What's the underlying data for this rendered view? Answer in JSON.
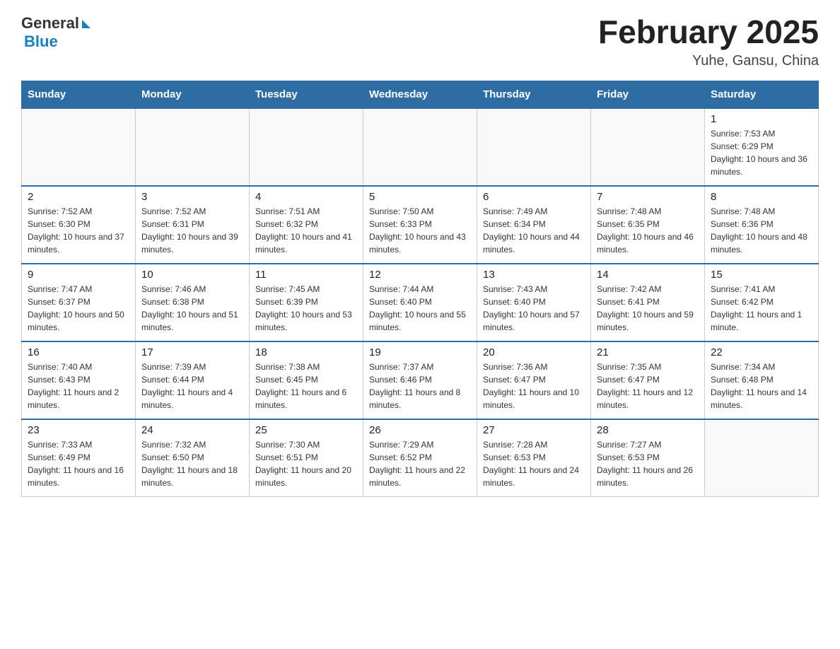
{
  "header": {
    "logo_general": "General",
    "logo_blue": "Blue",
    "month_title": "February 2025",
    "location": "Yuhe, Gansu, China"
  },
  "weekdays": [
    "Sunday",
    "Monday",
    "Tuesday",
    "Wednesday",
    "Thursday",
    "Friday",
    "Saturday"
  ],
  "weeks": [
    [
      {
        "day": "",
        "empty": true
      },
      {
        "day": "",
        "empty": true
      },
      {
        "day": "",
        "empty": true
      },
      {
        "day": "",
        "empty": true
      },
      {
        "day": "",
        "empty": true
      },
      {
        "day": "",
        "empty": true
      },
      {
        "day": "1",
        "sunrise": "7:53 AM",
        "sunset": "6:29 PM",
        "daylight": "10 hours and 36 minutes."
      }
    ],
    [
      {
        "day": "2",
        "sunrise": "7:52 AM",
        "sunset": "6:30 PM",
        "daylight": "10 hours and 37 minutes."
      },
      {
        "day": "3",
        "sunrise": "7:52 AM",
        "sunset": "6:31 PM",
        "daylight": "10 hours and 39 minutes."
      },
      {
        "day": "4",
        "sunrise": "7:51 AM",
        "sunset": "6:32 PM",
        "daylight": "10 hours and 41 minutes."
      },
      {
        "day": "5",
        "sunrise": "7:50 AM",
        "sunset": "6:33 PM",
        "daylight": "10 hours and 43 minutes."
      },
      {
        "day": "6",
        "sunrise": "7:49 AM",
        "sunset": "6:34 PM",
        "daylight": "10 hours and 44 minutes."
      },
      {
        "day": "7",
        "sunrise": "7:48 AM",
        "sunset": "6:35 PM",
        "daylight": "10 hours and 46 minutes."
      },
      {
        "day": "8",
        "sunrise": "7:48 AM",
        "sunset": "6:36 PM",
        "daylight": "10 hours and 48 minutes."
      }
    ],
    [
      {
        "day": "9",
        "sunrise": "7:47 AM",
        "sunset": "6:37 PM",
        "daylight": "10 hours and 50 minutes."
      },
      {
        "day": "10",
        "sunrise": "7:46 AM",
        "sunset": "6:38 PM",
        "daylight": "10 hours and 51 minutes."
      },
      {
        "day": "11",
        "sunrise": "7:45 AM",
        "sunset": "6:39 PM",
        "daylight": "10 hours and 53 minutes."
      },
      {
        "day": "12",
        "sunrise": "7:44 AM",
        "sunset": "6:40 PM",
        "daylight": "10 hours and 55 minutes."
      },
      {
        "day": "13",
        "sunrise": "7:43 AM",
        "sunset": "6:40 PM",
        "daylight": "10 hours and 57 minutes."
      },
      {
        "day": "14",
        "sunrise": "7:42 AM",
        "sunset": "6:41 PM",
        "daylight": "10 hours and 59 minutes."
      },
      {
        "day": "15",
        "sunrise": "7:41 AM",
        "sunset": "6:42 PM",
        "daylight": "11 hours and 1 minute."
      }
    ],
    [
      {
        "day": "16",
        "sunrise": "7:40 AM",
        "sunset": "6:43 PM",
        "daylight": "11 hours and 2 minutes."
      },
      {
        "day": "17",
        "sunrise": "7:39 AM",
        "sunset": "6:44 PM",
        "daylight": "11 hours and 4 minutes."
      },
      {
        "day": "18",
        "sunrise": "7:38 AM",
        "sunset": "6:45 PM",
        "daylight": "11 hours and 6 minutes."
      },
      {
        "day": "19",
        "sunrise": "7:37 AM",
        "sunset": "6:46 PM",
        "daylight": "11 hours and 8 minutes."
      },
      {
        "day": "20",
        "sunrise": "7:36 AM",
        "sunset": "6:47 PM",
        "daylight": "11 hours and 10 minutes."
      },
      {
        "day": "21",
        "sunrise": "7:35 AM",
        "sunset": "6:47 PM",
        "daylight": "11 hours and 12 minutes."
      },
      {
        "day": "22",
        "sunrise": "7:34 AM",
        "sunset": "6:48 PM",
        "daylight": "11 hours and 14 minutes."
      }
    ],
    [
      {
        "day": "23",
        "sunrise": "7:33 AM",
        "sunset": "6:49 PM",
        "daylight": "11 hours and 16 minutes."
      },
      {
        "day": "24",
        "sunrise": "7:32 AM",
        "sunset": "6:50 PM",
        "daylight": "11 hours and 18 minutes."
      },
      {
        "day": "25",
        "sunrise": "7:30 AM",
        "sunset": "6:51 PM",
        "daylight": "11 hours and 20 minutes."
      },
      {
        "day": "26",
        "sunrise": "7:29 AM",
        "sunset": "6:52 PM",
        "daylight": "11 hours and 22 minutes."
      },
      {
        "day": "27",
        "sunrise": "7:28 AM",
        "sunset": "6:53 PM",
        "daylight": "11 hours and 24 minutes."
      },
      {
        "day": "28",
        "sunrise": "7:27 AM",
        "sunset": "6:53 PM",
        "daylight": "11 hours and 26 minutes."
      },
      {
        "day": "",
        "empty": true
      }
    ]
  ]
}
